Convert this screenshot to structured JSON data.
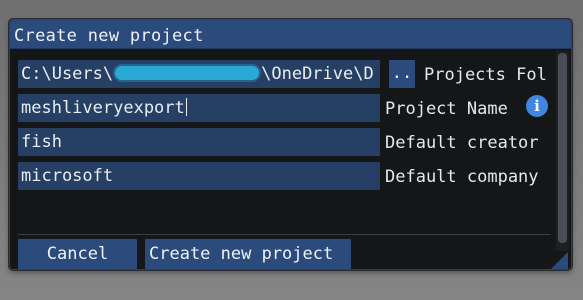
{
  "dialog": {
    "title": "Create new project"
  },
  "fields": {
    "path": {
      "prefix": "C:\\Users\\",
      "suffix": "\\OneDrive\\D",
      "label": "Projects Fol",
      "browse_label": ".."
    },
    "project_name": {
      "value": "meshliveryexport",
      "label": "Project Name",
      "info_icon": "i"
    },
    "creator": {
      "value": "fish",
      "label": "Default creator"
    },
    "company": {
      "value": "microsoft",
      "label": "Default company"
    }
  },
  "buttons": {
    "cancel": "Cancel",
    "create": "Create new project"
  },
  "colors": {
    "accent": "#2c4b7d",
    "field_bg": "#263f64",
    "dialog_bg": "#151618",
    "info": "#3f86e0"
  },
  "icons": {
    "info": "info-icon",
    "resize": "resize-grip-icon"
  }
}
